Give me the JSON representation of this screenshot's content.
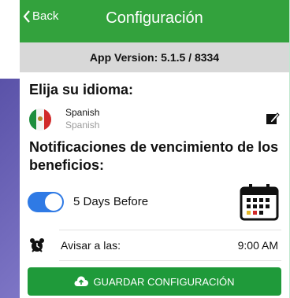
{
  "navbar": {
    "back_label": "Back",
    "title": "Configuración"
  },
  "version": {
    "text": "App Version: 5.1.5 / 8334"
  },
  "language": {
    "heading": "Elija su idioma:",
    "name": "Spanish",
    "subtitle": "Spanish"
  },
  "notifications": {
    "heading": "Notificaciones de vencimiento de los beneficios:",
    "days_label": "5 Days Before",
    "toggle_on": true
  },
  "alarm": {
    "label": "Avisar a las:",
    "time": "9:00 AM"
  },
  "save_button": {
    "label": "GUARDAR CONFIGURACIÓN"
  },
  "colors": {
    "navbar": "#33a23d",
    "save": "#1f9a3a",
    "toggle": "#2f7ae5"
  }
}
